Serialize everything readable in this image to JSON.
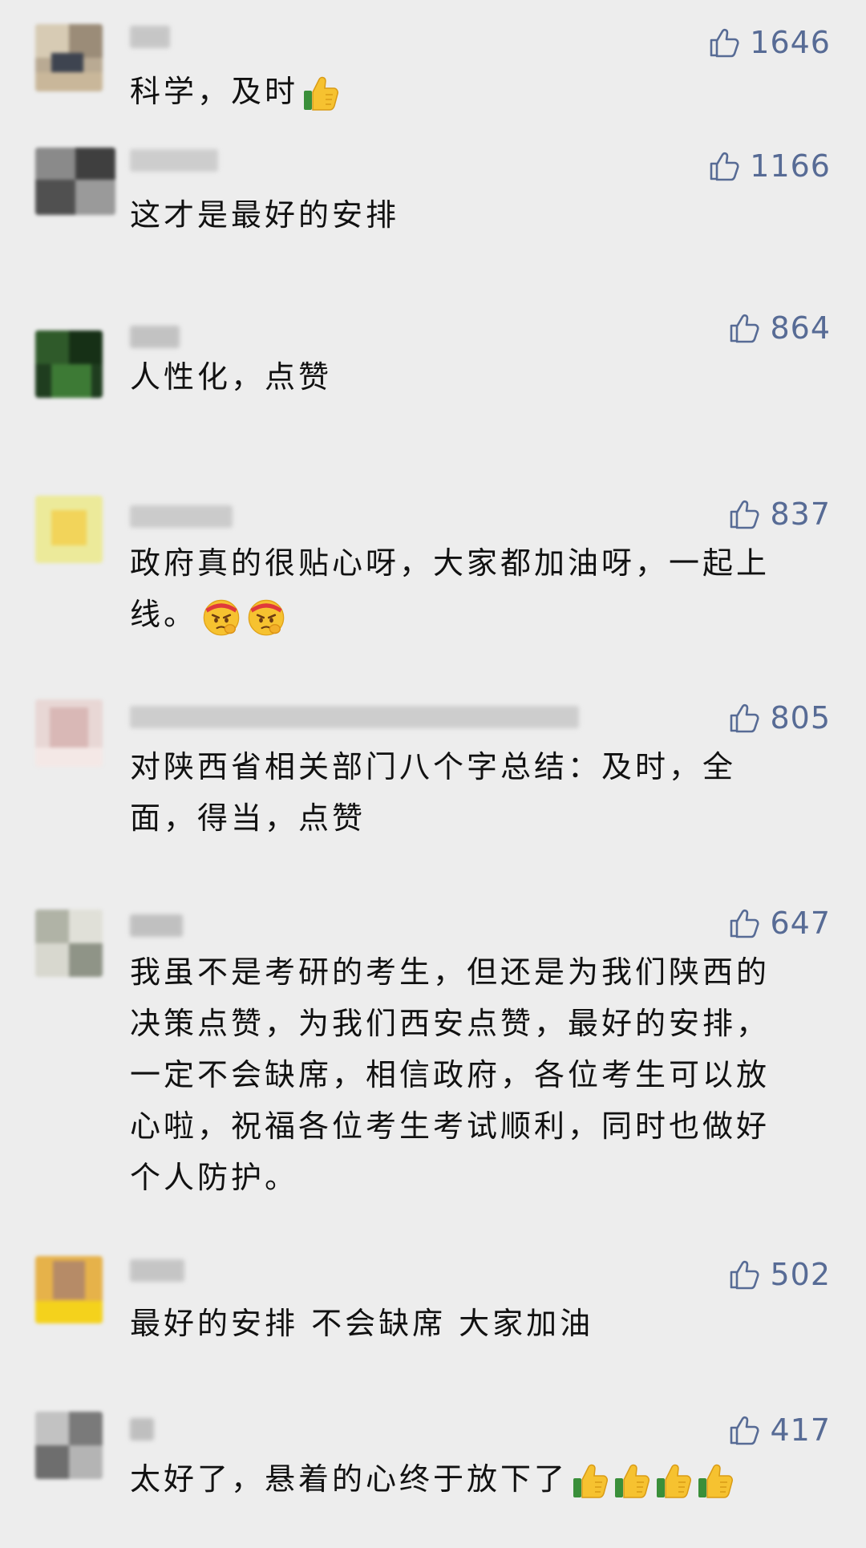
{
  "colors": {
    "background": "#ededed",
    "like_accent": "#576b95",
    "text": "#111111"
  },
  "comments": [
    {
      "likes": "1646",
      "text": "科学，及时",
      "emojis": [
        "thumbs-up-icon"
      ]
    },
    {
      "likes": "1166",
      "text": "这才是最好的安排",
      "emojis": []
    },
    {
      "likes": "864",
      "text": "人性化，点赞",
      "emojis": []
    },
    {
      "likes": "837",
      "text_line1": "政府真的很贴心呀，大家都加油呀，一起上",
      "text_line2": "线。",
      "emojis": [
        "determined-face-icon",
        "determined-face-icon"
      ]
    },
    {
      "likes": "805",
      "text_line1": "对陕西省相关部门八个字总结：及时，全",
      "text_line2": "面，得当，点赞",
      "emojis": []
    },
    {
      "likes": "647",
      "text_line1": "我虽不是考研的考生，但还是为我们陕西的",
      "text_line2": "决策点赞，为我们西安点赞，最好的安排，",
      "text_line3": "一定不会缺席，相信政府，各位考生可以放",
      "text_line4": "心啦，祝福各位考生考试顺利，同时也做好",
      "text_line5": "个人防护。",
      "emojis": []
    },
    {
      "likes": "502",
      "text": "最好的安排 不会缺席 大家加油",
      "emojis": []
    },
    {
      "likes": "417",
      "text": "太好了，悬着的心终于放下了",
      "emojis": [
        "thumbs-up-icon",
        "thumbs-up-icon",
        "thumbs-up-icon",
        "thumbs-up-icon"
      ]
    }
  ]
}
